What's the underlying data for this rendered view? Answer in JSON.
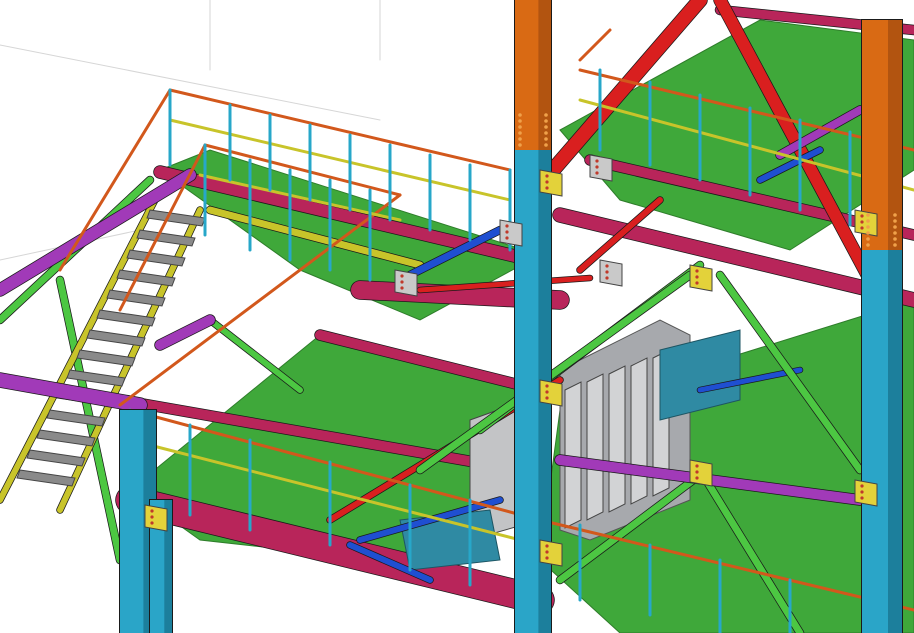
{
  "viewport": {
    "background": "#ffffff",
    "construction_line_color": "#d6d6d6"
  },
  "palette": {
    "floor_plate": "#3fa83a",
    "floor_plate_edge": "#2e7d2a",
    "main_beam": "#b8255a",
    "main_beam_dark": "#8f1c45",
    "column": "#2aa5c8",
    "column_dark": "#1c7f9c",
    "column_cap": "#d96a14",
    "bracing_red": "#d91f1f",
    "bracing_green": "#4cc742",
    "bracing_blue": "#1f4fd1",
    "handrail_orange": "#d2581c",
    "handrail_yellow": "#c8c42a",
    "handrail_post": "#27a7c9",
    "purlin_purple": "#a13ab8",
    "stair_grey": "#8a8a8a",
    "stair_stringer": "#c8c42a",
    "gusset_yellow": "#e3d23a",
    "equipment_grey": "#a7a9ad",
    "equipment_teal": "#2f8aa3",
    "bolt": "#c0392b",
    "gusset_grey": "#c9c9c9"
  },
  "components": [
    "upper-platform",
    "lower-platform",
    "stair-flight",
    "main-column-center",
    "main-column-right",
    "diagonal-bracing",
    "handrails",
    "equipment-frame"
  ]
}
